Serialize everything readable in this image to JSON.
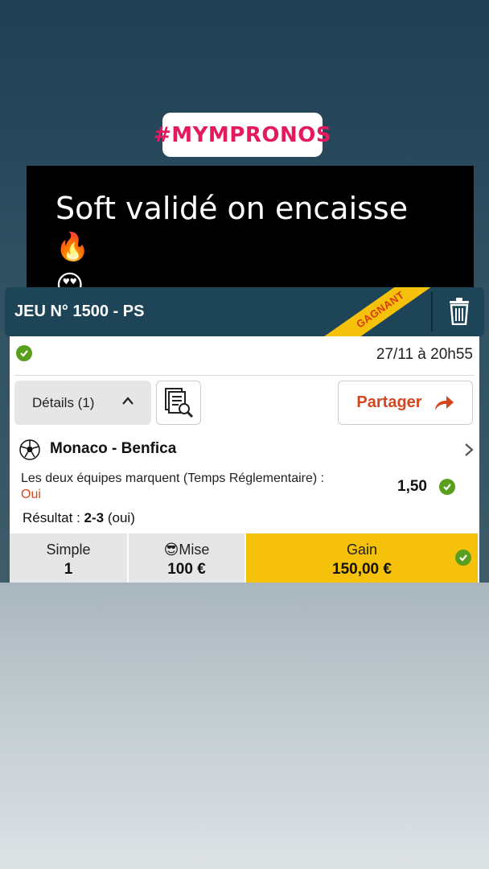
{
  "story": {
    "hashtag": "#MYMPRONOS",
    "caption_text": "Soft validé on encaisse",
    "caption_emoji_1": "🔥",
    "caption_emoji_2": "😍"
  },
  "ticket": {
    "title": "JEU N° 1500 - PS",
    "ribbon": "GAGNANT",
    "date": "27/11 à 20h55",
    "details_label": "Détails (1)",
    "share_label": "Partager",
    "match": "Monaco - Benfica",
    "market": "Les deux équipes marquent (Temps Réglementaire) :",
    "selection": "Oui",
    "odds": "1,50",
    "result_label": "Résultat :",
    "result_score": "2-3",
    "result_note": "(oui)",
    "type_label": "Simple",
    "type_value": "1",
    "stake_label": "Mise",
    "stake_emoji": "😎",
    "stake_value": "100 €",
    "gain_label": "Gain",
    "gain_value": "150,00 €"
  },
  "colors": {
    "accent": "#d6461c",
    "win_yellow": "#f5c10b",
    "check_green": "#5a9e1e",
    "header_bg": "#1e4458",
    "hashtag_pink": "#e5195f"
  },
  "icons": [
    "fire-icon",
    "heart-eyes-icon",
    "trash-icon",
    "check-circle-icon",
    "chevron-up-icon",
    "search-document-icon",
    "share-arrow-icon",
    "soccer-ball-icon",
    "chevron-right-icon",
    "sunglasses-emoji-icon"
  ]
}
